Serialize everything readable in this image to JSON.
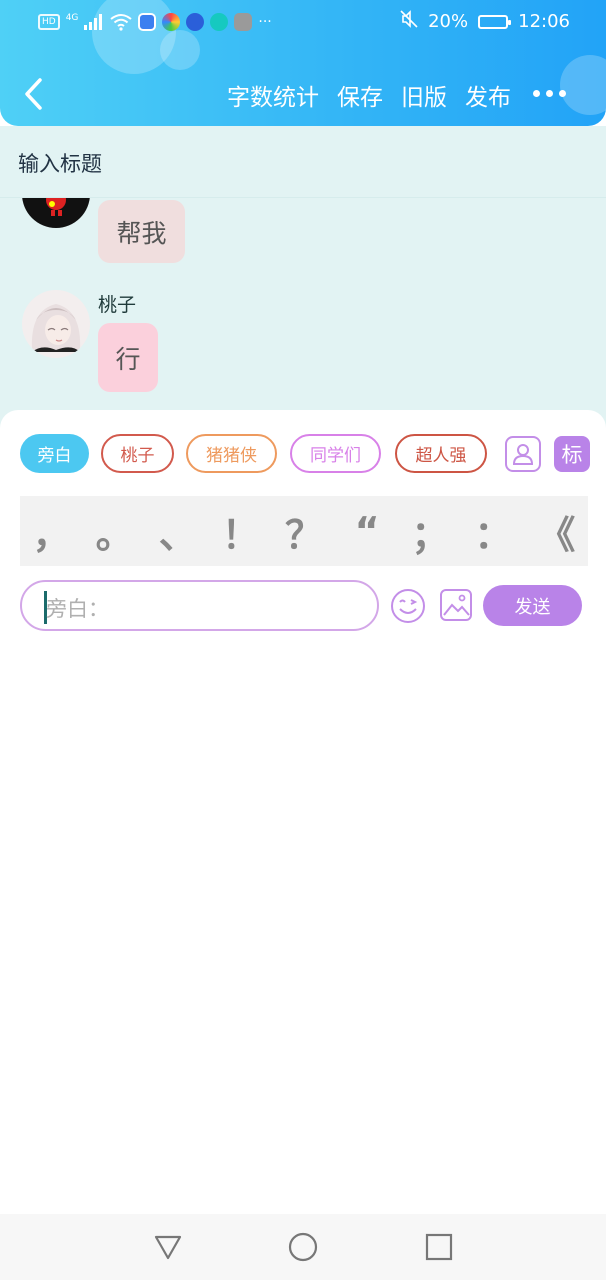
{
  "status_bar": {
    "left_badges": [
      "HD",
      "4G"
    ],
    "battery_percent": "20%",
    "time": "12:06",
    "more_indicator": "···"
  },
  "toolbar": {
    "actions": [
      "字数统计",
      "保存",
      "旧版",
      "发布"
    ]
  },
  "title": {
    "placeholder": "输入标题"
  },
  "messages": [
    {
      "text": "帮我",
      "bubble_color": "#f0dede"
    },
    {
      "speaker": "桃子",
      "text": "行",
      "bubble_color": "#fbd0dc"
    }
  ],
  "roles": [
    {
      "label": "旁白",
      "color": "#4cc8f1",
      "active": true
    },
    {
      "label": "桃子",
      "color": "#d25a4d",
      "active": false
    },
    {
      "label": "猪猪侠",
      "color": "#ee9a5e",
      "active": false
    },
    {
      "label": "同学们",
      "color": "#d881e8",
      "active": false
    },
    {
      "label": "超人强",
      "color": "#cd5544",
      "active": false
    }
  ],
  "tag_button": "标",
  "punctuation": [
    "，",
    "。",
    "、",
    "！",
    "？",
    "“",
    "；",
    "：",
    "《"
  ],
  "input": {
    "placeholder": "旁白："
  },
  "send_label": "发送",
  "colors": {
    "header_start": "#4fd0f6",
    "header_end": "#22a3f7",
    "chat_bg": "#e2f3f3",
    "accent_purple": "#b983e8"
  }
}
